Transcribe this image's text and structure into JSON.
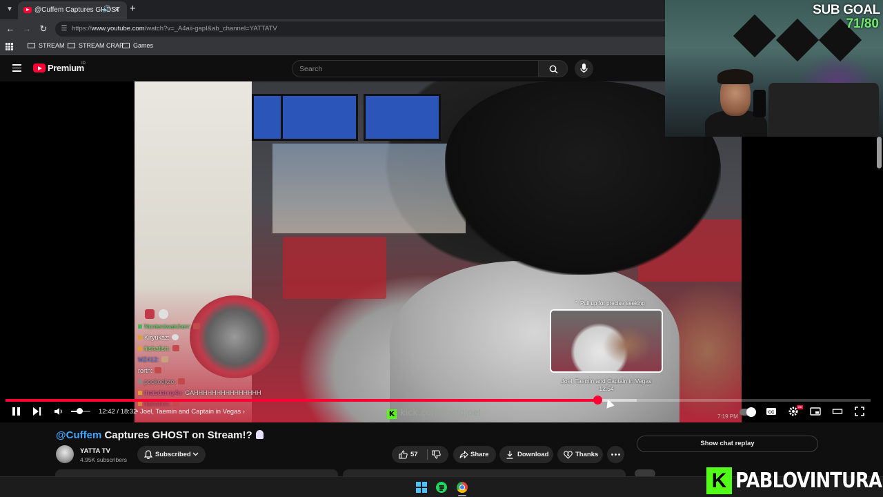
{
  "browser": {
    "tab_title": "@Cuffem Captures GHOST",
    "url_prefix": "https://",
    "url_host": "www.youtube.com",
    "url_path": "/watch?v=_A4aii-gapI&ab_channel=YATTATV",
    "bookmarks": [
      "STREAM",
      "STREAM CRAP",
      "Games"
    ]
  },
  "youtube": {
    "brand": "Premium",
    "region": "ID",
    "search_placeholder": "Search"
  },
  "player": {
    "current_time": "12:42",
    "duration": "18:32",
    "time_display": "12:42 / 18:32",
    "chapter": "Joel, Taemin and Captain in Vegas",
    "played_fraction": 0.685,
    "buffered_fraction": 0.73,
    "volume_fraction": 0.45,
    "seek_hint": "Pull up for precise seeking",
    "preview_title": "Joel, Taemin and Captain in Vegas",
    "preview_time": "12:54",
    "clock": "7:19 PM",
    "hd_badge": "HD",
    "watermark": "kick.com/kangjoel"
  },
  "chat_overlay": [
    {
      "user": "Nonteniwatcherr:",
      "msg": "",
      "color": "#4fd35a"
    },
    {
      "user": "Kiryukaz:",
      "msg": "",
      "color": "#f1f1f1"
    },
    {
      "user": "fiishafish:",
      "msg": "",
      "color": "#6fe36a"
    },
    {
      "user": "MZ412:",
      "msg": "",
      "color": "#4f7fe8"
    },
    {
      "user": "rorth:",
      "msg": "",
      "color": "#f1f1f1"
    },
    {
      "user": "pookoekze:",
      "msg": "",
      "color": "#a0a0a0"
    },
    {
      "user": "thatsdanny4u:",
      "msg": "GAHHHHHHHHHHHHHHH",
      "color": "#d05a9a"
    },
    {
      "user": "fiishafish:",
      "msg": "",
      "color": "#c24a6a"
    }
  ],
  "video": {
    "title_mention": "@Cuffem",
    "title_rest": "Captures GHOST on Stream!?",
    "channel_name": "YATTA TV",
    "subscribers": "4.95K subscribers",
    "subscribed_label": "Subscribed",
    "likes": "57",
    "share_label": "Share",
    "download_label": "Download",
    "thanks_label": "Thanks",
    "chat_replay_label": "Show chat replay"
  },
  "stream_overlay": {
    "sub_goal_label": "SUB GOAL",
    "sub_goal_value": "71/80",
    "kick_letter": "K",
    "streamer_name": "PABLOVINTURA"
  },
  "colors": {
    "youtube_red": "#ff0033",
    "kick_green": "#53fc18",
    "mention_blue": "#3ea6ff",
    "goal_green": "#6ee86a"
  },
  "icons": {
    "search": "search-icon",
    "mic": "mic-icon",
    "like": "thumbs-up-icon",
    "dislike": "thumbs-down-icon",
    "share": "share-icon",
    "download": "download-icon",
    "thanks": "dollar-heart-icon",
    "more": "more-horizontal-icon"
  }
}
